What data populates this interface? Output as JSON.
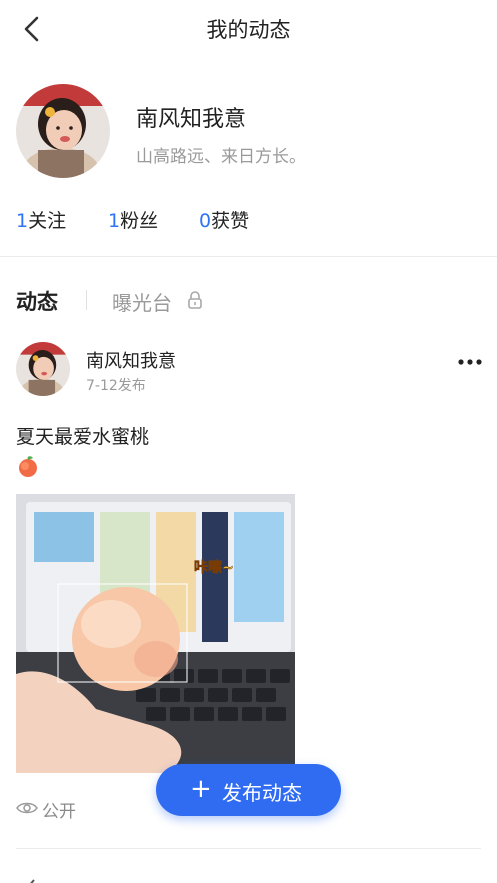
{
  "header": {
    "title": "我的动态"
  },
  "profile": {
    "name": "南风知我意",
    "bio": "山高路远、来日方长。",
    "stats": [
      {
        "count": "1",
        "label": "关注"
      },
      {
        "count": "1",
        "label": "粉丝"
      },
      {
        "count": "0",
        "label": "获赞"
      }
    ]
  },
  "tabs": {
    "active": "动态",
    "locked": "曝光台"
  },
  "post": {
    "author": "南风知我意",
    "date": "7-12发布",
    "text": "夏天最爱水蜜桃",
    "emoji_icon": "peach-icon",
    "image_caption": "咔嚓~",
    "visibility": "公开"
  },
  "fab": {
    "plus": "+",
    "label": "发布动态"
  },
  "colors": {
    "accent": "#2f73f6",
    "fab": "#2f6cf2",
    "muted": "#9a9a9a"
  }
}
